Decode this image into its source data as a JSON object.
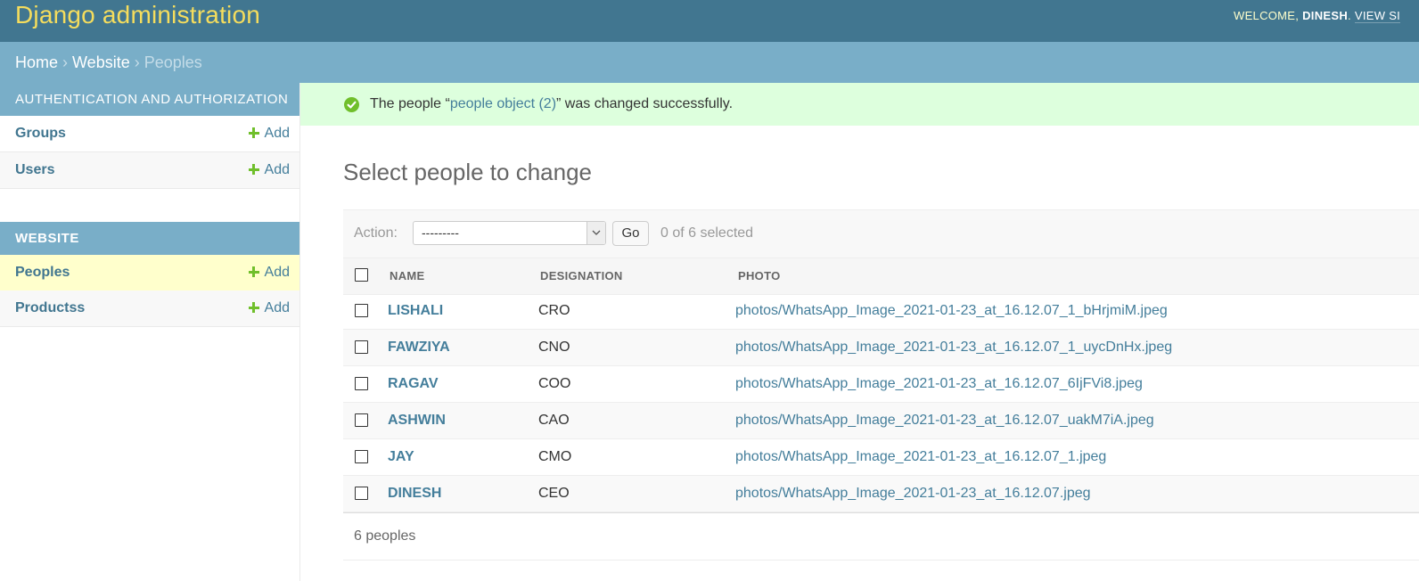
{
  "header": {
    "brand": "Django administration",
    "welcome": "WELCOME,",
    "username": "DINESH",
    "view_site": "VIEW SI"
  },
  "breadcrumbs": {
    "home": "Home",
    "website": "Website",
    "current": "Peoples",
    "separator": "›"
  },
  "sidebar": {
    "modules": [
      {
        "caption": "Authentication and Authorization",
        "models": [
          {
            "name": "Groups",
            "add": "Add"
          },
          {
            "name": "Users",
            "add": "Add"
          }
        ]
      },
      {
        "caption": "Website",
        "models": [
          {
            "name": "Peoples",
            "add": "Add"
          },
          {
            "name": "Productss",
            "add": "Add"
          }
        ]
      }
    ]
  },
  "message": {
    "prefix": "The people “",
    "link": "people object (2)",
    "suffix": "” was changed successfully."
  },
  "page_title": "Select people to change",
  "actions": {
    "label": "Action:",
    "selected": "---------",
    "go": "Go",
    "counter": "0 of 6 selected"
  },
  "table": {
    "columns": [
      "Name",
      "Designation",
      "Photo"
    ],
    "rows": [
      {
        "name": "LISHALI",
        "designation": "CRO",
        "photo": "photos/WhatsApp_Image_2021-01-23_at_16.12.07_1_bHrjmiM.jpeg"
      },
      {
        "name": "FAWZIYA",
        "designation": "CNO",
        "photo": "photos/WhatsApp_Image_2021-01-23_at_16.12.07_1_uycDnHx.jpeg"
      },
      {
        "name": "RAGAV",
        "designation": "COO",
        "photo": "photos/WhatsApp_Image_2021-01-23_at_16.12.07_6IjFVi8.jpeg"
      },
      {
        "name": "ASHWIN",
        "designation": "CAO",
        "photo": "photos/WhatsApp_Image_2021-01-23_at_16.12.07_uakM7iA.jpeg"
      },
      {
        "name": "JAY",
        "designation": "CMO",
        "photo": "photos/WhatsApp_Image_2021-01-23_at_16.12.07_1.jpeg"
      },
      {
        "name": "DINESH",
        "designation": "CEO",
        "photo": "photos/WhatsApp_Image_2021-01-23_at_16.12.07.jpeg"
      }
    ]
  },
  "paginator": "6 peoples",
  "colors": {
    "header_bg": "#417690",
    "brand": "#f5dd5d",
    "breadcrumbs_bg": "#79aec8",
    "success_bg": "#ddffdd",
    "link": "#447e9b",
    "add_green": "#70bf2b"
  },
  "icons": {
    "success": "check-circle-icon",
    "add": "plus-icon",
    "dropdown": "chevron-down-icon"
  }
}
